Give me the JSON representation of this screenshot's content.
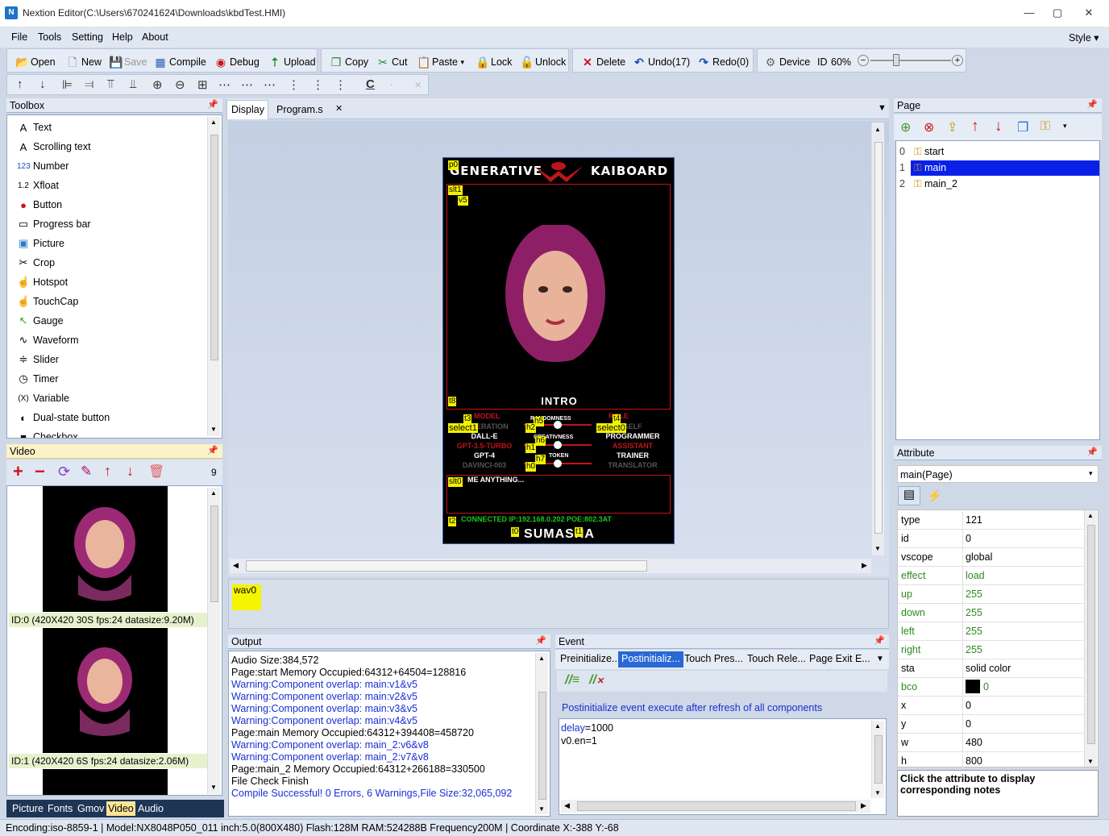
{
  "window": {
    "title": "Nextion Editor(C:\\Users\\670241624\\Downloads\\kbdTest.HMI)",
    "icon": "N"
  },
  "menu": [
    "File",
    "Tools",
    "Setting",
    "Help",
    "About"
  ],
  "style_menu": "Style",
  "toolbar": [
    {
      "label": "Open",
      "icon": "open-folder-icon",
      "glyph": "📂"
    },
    {
      "label": "New",
      "icon": "new-file-icon",
      "glyph": "🗋"
    },
    {
      "label": "Save",
      "icon": "save-icon",
      "glyph": "💾"
    },
    {
      "label": "Compile",
      "icon": "compile-icon",
      "glyph": "▦"
    },
    {
      "label": "Debug",
      "icon": "debug-icon",
      "glyph": "◉"
    },
    {
      "label": "Upload",
      "icon": "upload-icon",
      "glyph": "⇡"
    },
    {
      "label": "Copy",
      "icon": "copy-icon",
      "glyph": "❐"
    },
    {
      "label": "Cut",
      "icon": "cut-icon",
      "glyph": "✂"
    },
    {
      "label": "Paste",
      "icon": "paste-icon",
      "glyph": "📋"
    },
    {
      "label": "Lock",
      "icon": "lock-icon",
      "glyph": "🔒"
    },
    {
      "label": "Unlock",
      "icon": "unlock-icon",
      "glyph": "🔓"
    },
    {
      "label": "Delete",
      "icon": "delete-icon",
      "glyph": "✕"
    },
    {
      "label": "Undo(17)",
      "icon": "undo-icon",
      "glyph": "↶"
    },
    {
      "label": "Redo(0)",
      "icon": "redo-icon",
      "glyph": "↷"
    },
    {
      "label": "Device",
      "icon": "device-gear-icon",
      "glyph": "⚙"
    },
    {
      "label": "ID",
      "icon": "",
      "glyph": ""
    },
    {
      "label": "60%",
      "icon": "",
      "glyph": ""
    }
  ],
  "zoom": {
    "percent": 60
  },
  "toolbox": {
    "title": "Toolbox",
    "items": [
      {
        "label": "Text",
        "icon": "text-icon",
        "glyph": "A"
      },
      {
        "label": "Scrolling text",
        "icon": "scrolling-text-icon",
        "glyph": "A"
      },
      {
        "label": "Number",
        "icon": "number-icon",
        "glyph": "123"
      },
      {
        "label": "Xfloat",
        "icon": "xfloat-icon",
        "glyph": "1.2"
      },
      {
        "label": "Button",
        "icon": "button-icon",
        "glyph": "●"
      },
      {
        "label": "Progress bar",
        "icon": "progress-bar-icon",
        "glyph": "▭"
      },
      {
        "label": "Picture",
        "icon": "picture-icon",
        "glyph": "▣"
      },
      {
        "label": "Crop",
        "icon": "crop-icon",
        "glyph": "✂"
      },
      {
        "label": "Hotspot",
        "icon": "hotspot-icon",
        "glyph": "☝"
      },
      {
        "label": "TouchCap",
        "icon": "touchcap-icon",
        "glyph": "☝"
      },
      {
        "label": "Gauge",
        "icon": "gauge-icon",
        "glyph": "↖"
      },
      {
        "label": "Waveform",
        "icon": "waveform-icon",
        "glyph": "∿"
      },
      {
        "label": "Slider",
        "icon": "slider-icon",
        "glyph": "≑"
      },
      {
        "label": "Timer",
        "icon": "timer-icon",
        "glyph": "◷"
      },
      {
        "label": "Variable",
        "icon": "variable-icon",
        "glyph": "(X)"
      },
      {
        "label": "Dual-state button",
        "icon": "dual-state-button-icon",
        "glyph": "◐"
      },
      {
        "label": "Checkbox",
        "icon": "checkbox-icon",
        "glyph": "■"
      }
    ]
  },
  "video_panel": {
    "title": "Video",
    "count": "9",
    "items": [
      {
        "label": "ID:0  (420X420 30S fps:24 datasize:9.20M)"
      },
      {
        "label": "ID:1  (420X420 6S fps:24 datasize:2.06M)"
      }
    ],
    "tabs": [
      "Picture",
      "Fonts",
      "Gmov",
      "Video",
      "Audio"
    ]
  },
  "display_tabs": [
    "Display",
    "Program.s"
  ],
  "device_screen": {
    "brand_left": "GENERATIVE",
    "brand_right": "KAIBOARD",
    "intro": "INTRO",
    "model_label": "MODEL",
    "models": [
      "GENERATION",
      "DALL-E",
      "GPT-3.5-TURBO",
      "GPT-4",
      "DAVINCI-003"
    ],
    "role_label": "ROLE",
    "roles": [
      "SELF",
      "PROGRAMMER",
      "ASSISTANT",
      "TRAINER",
      "TRANSLATOR"
    ],
    "randomness": "RANDOMNESS",
    "creativeness": "CREATIVNESS",
    "token": "TOKEN",
    "prompt": "ME ANYTHING...",
    "status": "CONNECTED  IP:192.168.0.202  POE:802.3AT",
    "footer": "SUMASHA",
    "tags": [
      "p0",
      "slt1",
      "v5",
      "t8",
      "t3",
      "h5",
      "t4",
      "select1",
      "h2",
      "select0",
      "h6",
      "h1",
      "h7",
      "h0",
      "slt0",
      "t2",
      "t0",
      "t1"
    ]
  },
  "timer_strip": [
    "wav0"
  ],
  "page_panel": {
    "title": "Page",
    "pages": [
      {
        "index": "0",
        "name": "start"
      },
      {
        "index": "1",
        "name": "main"
      },
      {
        "index": "2",
        "name": "main_2"
      }
    ],
    "selected": 1
  },
  "attribute_panel": {
    "title": "Attribute",
    "selector": "main(Page)",
    "rows": [
      {
        "key": "type",
        "value": "121",
        "green": false
      },
      {
        "key": "id",
        "value": "0",
        "green": false
      },
      {
        "key": "vscope",
        "value": "global",
        "green": false
      },
      {
        "key": "effect",
        "value": "load",
        "green": true
      },
      {
        "key": "up",
        "value": "255",
        "green": true
      },
      {
        "key": "down",
        "value": "255",
        "green": true
      },
      {
        "key": "left",
        "value": "255",
        "green": true
      },
      {
        "key": "right",
        "value": "255",
        "green": true
      },
      {
        "key": "sta",
        "value": "solid color",
        "green": false
      },
      {
        "key": "bco",
        "value": "0",
        "green": true
      },
      {
        "key": "x",
        "value": "0",
        "green": false
      },
      {
        "key": "y",
        "value": "0",
        "green": false
      },
      {
        "key": "w",
        "value": "480",
        "green": false
      },
      {
        "key": "h",
        "value": "800",
        "green": false
      }
    ],
    "note": "Click the attribute to display corresponding notes"
  },
  "output_panel": {
    "title": "Output",
    "lines": [
      {
        "text": "Audio Size:384,572",
        "warn": false
      },
      {
        "text": "Page:start Memory Occupied:64312+64504=128816",
        "warn": false
      },
      {
        "text": "Warning:Component overlap: main:v1&v5",
        "warn": true
      },
      {
        "text": "Warning:Component overlap: main:v2&v5",
        "warn": true
      },
      {
        "text": "Warning:Component overlap: main:v3&v5",
        "warn": true
      },
      {
        "text": "Warning:Component overlap: main:v4&v5",
        "warn": true
      },
      {
        "text": "Page:main Memory Occupied:64312+394408=458720",
        "warn": false
      },
      {
        "text": "Warning:Component overlap: main_2:v6&v8",
        "warn": true
      },
      {
        "text": "Warning:Component overlap: main_2:v7&v8",
        "warn": true
      },
      {
        "text": "Page:main_2 Memory Occupied:64312+266188=330500",
        "warn": false
      },
      {
        "text": "File Check Finish",
        "warn": false
      },
      {
        "text": "Compile Successful! 0 Errors, 6 Warnings,File Size:32,065,092",
        "warn": true
      }
    ]
  },
  "event_panel": {
    "title": "Event",
    "tabs": [
      "Preinitialize...",
      "Postinitializ...",
      "Touch Pres...",
      "Touch Rele...",
      "Page Exit E..."
    ],
    "active_tab": 1,
    "description": "Postinitialize event execute after refresh of all components",
    "code": [
      "delay=1000",
      "v0.en=1"
    ]
  },
  "statusbar": "Encoding:iso-8859-1 | Model:NX8048P050_011 inch:5.0(800X480) Flash:128M RAM:524288B Frequency200M |    Coordinate X:-388  Y:-68"
}
